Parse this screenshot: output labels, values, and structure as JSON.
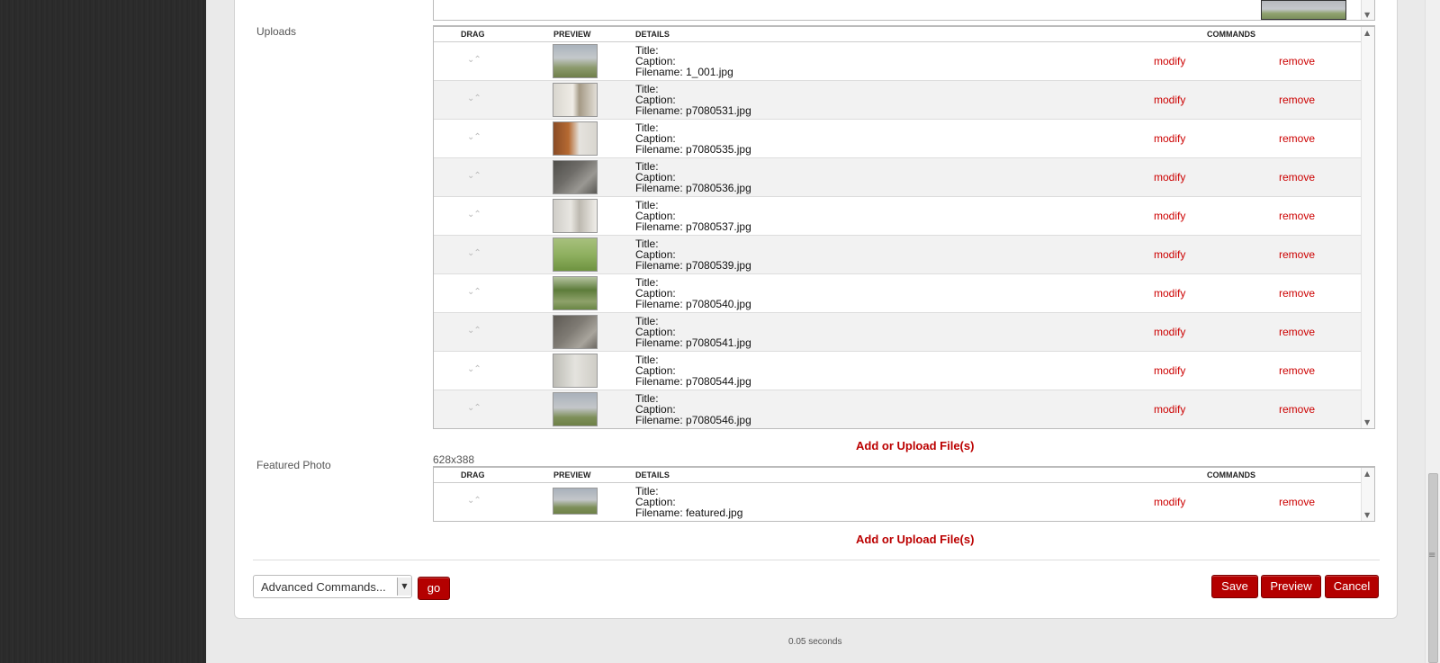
{
  "page": {
    "footer_time": "0.05 seconds"
  },
  "uploads": {
    "label": "Uploads",
    "headers": {
      "drag": "DRAG",
      "preview": "PREVIEW",
      "details": "DETAILS",
      "commands": "COMMANDS"
    },
    "rows": [
      {
        "title": "Title:",
        "caption": "Caption:",
        "filename": "Filename: 1_001.jpg",
        "modify": "modify",
        "remove": "remove"
      },
      {
        "title": "Title:",
        "caption": "Caption:",
        "filename": "Filename: p7080531.jpg",
        "modify": "modify",
        "remove": "remove"
      },
      {
        "title": "Title:",
        "caption": "Caption:",
        "filename": "Filename: p7080535.jpg",
        "modify": "modify",
        "remove": "remove"
      },
      {
        "title": "Title:",
        "caption": "Caption:",
        "filename": "Filename: p7080536.jpg",
        "modify": "modify",
        "remove": "remove"
      },
      {
        "title": "Title:",
        "caption": "Caption:",
        "filename": "Filename: p7080537.jpg",
        "modify": "modify",
        "remove": "remove"
      },
      {
        "title": "Title:",
        "caption": "Caption:",
        "filename": "Filename: p7080539.jpg",
        "modify": "modify",
        "remove": "remove"
      },
      {
        "title": "Title:",
        "caption": "Caption:",
        "filename": "Filename: p7080540.jpg",
        "modify": "modify",
        "remove": "remove"
      },
      {
        "title": "Title:",
        "caption": "Caption:",
        "filename": "Filename: p7080541.jpg",
        "modify": "modify",
        "remove": "remove"
      },
      {
        "title": "Title:",
        "caption": "Caption:",
        "filename": "Filename: p7080544.jpg",
        "modify": "modify",
        "remove": "remove"
      },
      {
        "title": "Title:",
        "caption": "Caption:",
        "filename": "Filename: p7080546.jpg",
        "modify": "modify",
        "remove": "remove"
      }
    ],
    "add_link": "Add or Upload File(s)"
  },
  "featured": {
    "label": "Featured Photo",
    "dimensions": "628x388",
    "headers": {
      "drag": "DRAG",
      "preview": "PREVIEW",
      "details": "DETAILS",
      "commands": "COMMANDS"
    },
    "row": {
      "title": "Title:",
      "caption": "Caption:",
      "filename": "Filename: featured.jpg",
      "modify": "modify",
      "remove": "remove"
    },
    "add_link": "Add or Upload File(s)"
  },
  "actions": {
    "select_value": "Advanced Commands...",
    "go": "go",
    "save": "Save",
    "preview": "Preview",
    "cancel": "Cancel"
  },
  "icons": {
    "drag": "drag-arrows-icon",
    "select_arrow": "dropdown-arrow-icon",
    "scroll": "scroll-arrow-icon"
  },
  "colors": {
    "accent": "#b40000",
    "link": "#cc0000",
    "sidebar": "#2b2b2b"
  }
}
